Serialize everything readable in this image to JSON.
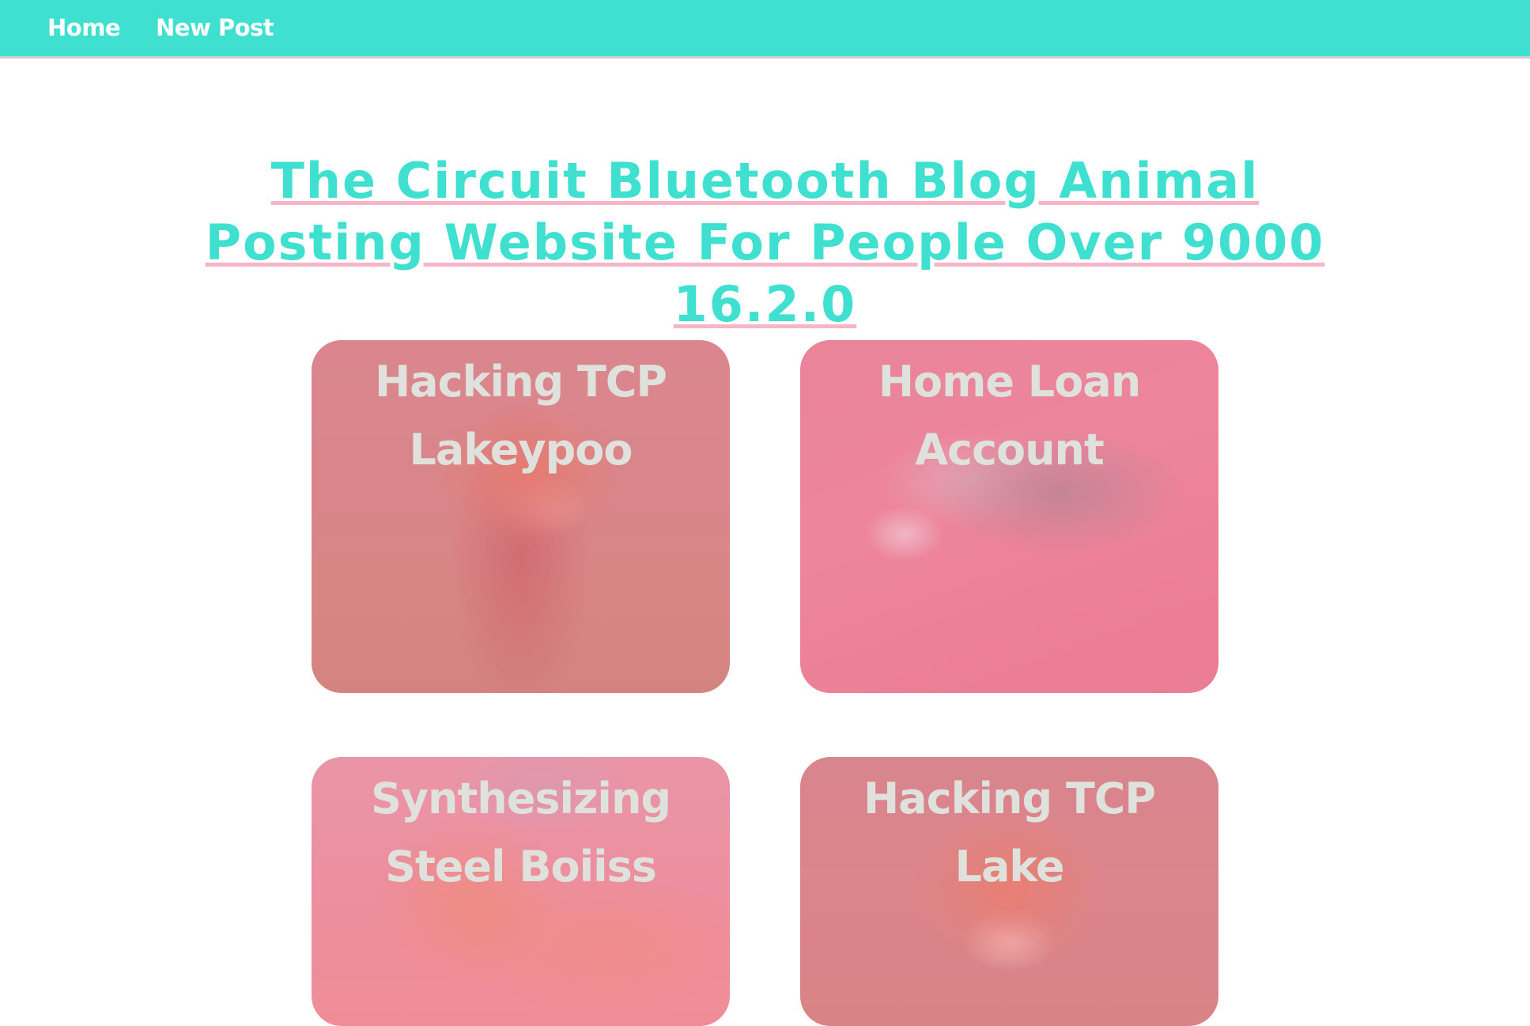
{
  "nav": {
    "home_label": "Home",
    "new_post_label": "New Post"
  },
  "header": {
    "title": "The Circuit Bluetooth Blog Animal Posting Website For People Over 9000 16.2.0"
  },
  "posts": [
    {
      "title": "Hacking TCP Lakeypoo",
      "image": "fox-running"
    },
    {
      "title": "Home Loan Account",
      "image": "cat-sleeping"
    },
    {
      "title": "Synthesizing Steel Boiiss",
      "image": "puppy"
    },
    {
      "title": "Hacking TCP Lake",
      "image": "fox-portrait"
    }
  ],
  "colors": {
    "accent": "#40E0D0",
    "underline": "#f7b6c8",
    "card_tint": "#f0789a"
  }
}
